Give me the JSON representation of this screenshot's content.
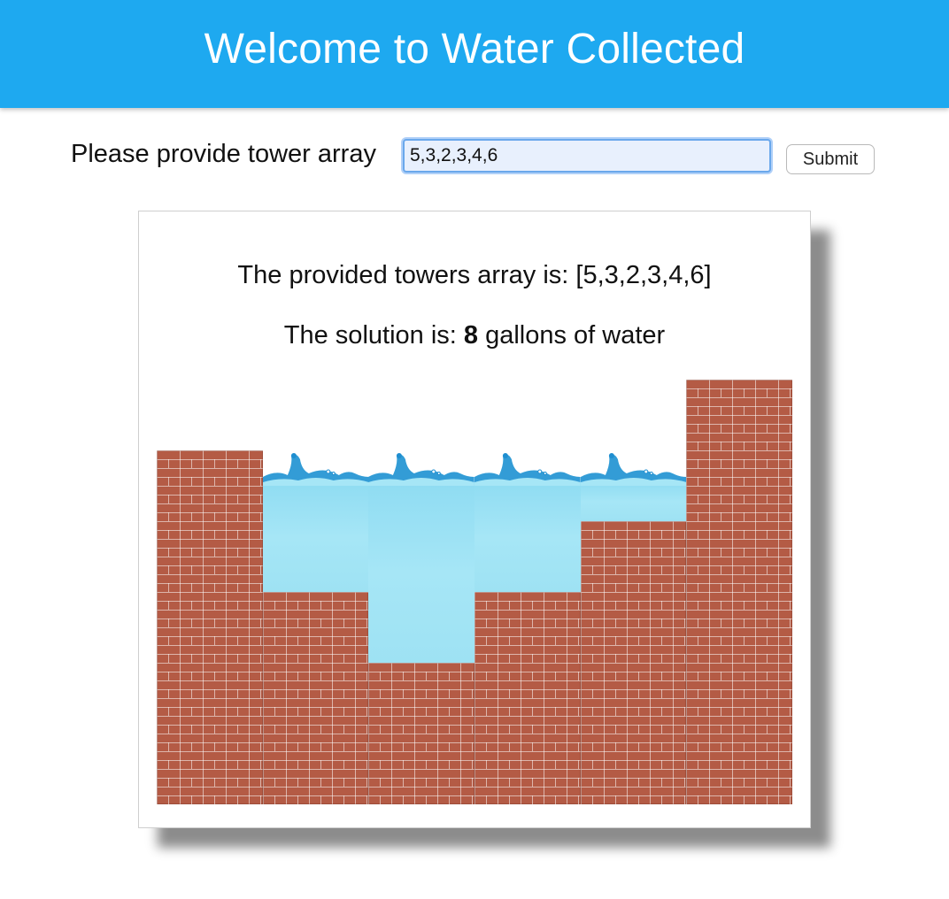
{
  "header": {
    "title": "Welcome to Water Collected"
  },
  "form": {
    "label": "Please provide tower array",
    "input_value": "5,3,2,3,4,6",
    "submit_label": "Submit"
  },
  "result": {
    "towers_prefix": "The provided towers array is: ",
    "towers_display": "[5,3,2,3,4,6]",
    "solution_prefix": "The solution is: ",
    "solution_value": "8",
    "solution_suffix": " gallons of water"
  },
  "visualization": {
    "towers": [
      5,
      3,
      2,
      3,
      4,
      6
    ],
    "water_level": 5,
    "water_per_tower": [
      0,
      2,
      3,
      2,
      1,
      0
    ],
    "colors": {
      "brick": "#b45b45",
      "water": "#9ee2f3",
      "wave": "#1f8ed0"
    }
  }
}
